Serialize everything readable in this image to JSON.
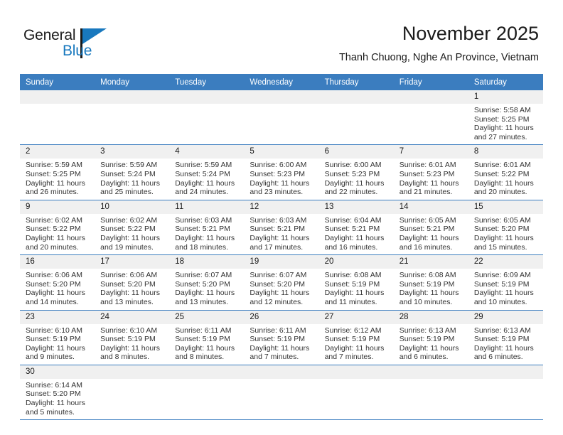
{
  "brand": {
    "name_top": "General",
    "name_bottom": "Blue",
    "accent_color": "#1878be",
    "flag_icon": "blue-triangle-flag"
  },
  "header": {
    "month_title": "November 2025",
    "location": "Thanh Chuong, Nghe An Province, Vietnam"
  },
  "calendar": {
    "header_color": "#3b7dbf",
    "daynum_band_color": "#f0f0f0",
    "weekdays": [
      "Sunday",
      "Monday",
      "Tuesday",
      "Wednesday",
      "Thursday",
      "Friday",
      "Saturday"
    ],
    "weeks": [
      [
        {
          "blank": true
        },
        {
          "blank": true
        },
        {
          "blank": true
        },
        {
          "blank": true
        },
        {
          "blank": true
        },
        {
          "blank": true
        },
        {
          "day": "1",
          "sunrise": "Sunrise: 5:58 AM",
          "sunset": "Sunset: 5:25 PM",
          "daylight_line1": "Daylight: 11 hours",
          "daylight_line2": "and 27 minutes."
        }
      ],
      [
        {
          "day": "2",
          "sunrise": "Sunrise: 5:59 AM",
          "sunset": "Sunset: 5:25 PM",
          "daylight_line1": "Daylight: 11 hours",
          "daylight_line2": "and 26 minutes."
        },
        {
          "day": "3",
          "sunrise": "Sunrise: 5:59 AM",
          "sunset": "Sunset: 5:24 PM",
          "daylight_line1": "Daylight: 11 hours",
          "daylight_line2": "and 25 minutes."
        },
        {
          "day": "4",
          "sunrise": "Sunrise: 5:59 AM",
          "sunset": "Sunset: 5:24 PM",
          "daylight_line1": "Daylight: 11 hours",
          "daylight_line2": "and 24 minutes."
        },
        {
          "day": "5",
          "sunrise": "Sunrise: 6:00 AM",
          "sunset": "Sunset: 5:23 PM",
          "daylight_line1": "Daylight: 11 hours",
          "daylight_line2": "and 23 minutes."
        },
        {
          "day": "6",
          "sunrise": "Sunrise: 6:00 AM",
          "sunset": "Sunset: 5:23 PM",
          "daylight_line1": "Daylight: 11 hours",
          "daylight_line2": "and 22 minutes."
        },
        {
          "day": "7",
          "sunrise": "Sunrise: 6:01 AM",
          "sunset": "Sunset: 5:23 PM",
          "daylight_line1": "Daylight: 11 hours",
          "daylight_line2": "and 21 minutes."
        },
        {
          "day": "8",
          "sunrise": "Sunrise: 6:01 AM",
          "sunset": "Sunset: 5:22 PM",
          "daylight_line1": "Daylight: 11 hours",
          "daylight_line2": "and 20 minutes."
        }
      ],
      [
        {
          "day": "9",
          "sunrise": "Sunrise: 6:02 AM",
          "sunset": "Sunset: 5:22 PM",
          "daylight_line1": "Daylight: 11 hours",
          "daylight_line2": "and 20 minutes."
        },
        {
          "day": "10",
          "sunrise": "Sunrise: 6:02 AM",
          "sunset": "Sunset: 5:22 PM",
          "daylight_line1": "Daylight: 11 hours",
          "daylight_line2": "and 19 minutes."
        },
        {
          "day": "11",
          "sunrise": "Sunrise: 6:03 AM",
          "sunset": "Sunset: 5:21 PM",
          "daylight_line1": "Daylight: 11 hours",
          "daylight_line2": "and 18 minutes."
        },
        {
          "day": "12",
          "sunrise": "Sunrise: 6:03 AM",
          "sunset": "Sunset: 5:21 PM",
          "daylight_line1": "Daylight: 11 hours",
          "daylight_line2": "and 17 minutes."
        },
        {
          "day": "13",
          "sunrise": "Sunrise: 6:04 AM",
          "sunset": "Sunset: 5:21 PM",
          "daylight_line1": "Daylight: 11 hours",
          "daylight_line2": "and 16 minutes."
        },
        {
          "day": "14",
          "sunrise": "Sunrise: 6:05 AM",
          "sunset": "Sunset: 5:21 PM",
          "daylight_line1": "Daylight: 11 hours",
          "daylight_line2": "and 16 minutes."
        },
        {
          "day": "15",
          "sunrise": "Sunrise: 6:05 AM",
          "sunset": "Sunset: 5:20 PM",
          "daylight_line1": "Daylight: 11 hours",
          "daylight_line2": "and 15 minutes."
        }
      ],
      [
        {
          "day": "16",
          "sunrise": "Sunrise: 6:06 AM",
          "sunset": "Sunset: 5:20 PM",
          "daylight_line1": "Daylight: 11 hours",
          "daylight_line2": "and 14 minutes."
        },
        {
          "day": "17",
          "sunrise": "Sunrise: 6:06 AM",
          "sunset": "Sunset: 5:20 PM",
          "daylight_line1": "Daylight: 11 hours",
          "daylight_line2": "and 13 minutes."
        },
        {
          "day": "18",
          "sunrise": "Sunrise: 6:07 AM",
          "sunset": "Sunset: 5:20 PM",
          "daylight_line1": "Daylight: 11 hours",
          "daylight_line2": "and 13 minutes."
        },
        {
          "day": "19",
          "sunrise": "Sunrise: 6:07 AM",
          "sunset": "Sunset: 5:20 PM",
          "daylight_line1": "Daylight: 11 hours",
          "daylight_line2": "and 12 minutes."
        },
        {
          "day": "20",
          "sunrise": "Sunrise: 6:08 AM",
          "sunset": "Sunset: 5:19 PM",
          "daylight_line1": "Daylight: 11 hours",
          "daylight_line2": "and 11 minutes."
        },
        {
          "day": "21",
          "sunrise": "Sunrise: 6:08 AM",
          "sunset": "Sunset: 5:19 PM",
          "daylight_line1": "Daylight: 11 hours",
          "daylight_line2": "and 10 minutes."
        },
        {
          "day": "22",
          "sunrise": "Sunrise: 6:09 AM",
          "sunset": "Sunset: 5:19 PM",
          "daylight_line1": "Daylight: 11 hours",
          "daylight_line2": "and 10 minutes."
        }
      ],
      [
        {
          "day": "23",
          "sunrise": "Sunrise: 6:10 AM",
          "sunset": "Sunset: 5:19 PM",
          "daylight_line1": "Daylight: 11 hours",
          "daylight_line2": "and 9 minutes."
        },
        {
          "day": "24",
          "sunrise": "Sunrise: 6:10 AM",
          "sunset": "Sunset: 5:19 PM",
          "daylight_line1": "Daylight: 11 hours",
          "daylight_line2": "and 8 minutes."
        },
        {
          "day": "25",
          "sunrise": "Sunrise: 6:11 AM",
          "sunset": "Sunset: 5:19 PM",
          "daylight_line1": "Daylight: 11 hours",
          "daylight_line2": "and 8 minutes."
        },
        {
          "day": "26",
          "sunrise": "Sunrise: 6:11 AM",
          "sunset": "Sunset: 5:19 PM",
          "daylight_line1": "Daylight: 11 hours",
          "daylight_line2": "and 7 minutes."
        },
        {
          "day": "27",
          "sunrise": "Sunrise: 6:12 AM",
          "sunset": "Sunset: 5:19 PM",
          "daylight_line1": "Daylight: 11 hours",
          "daylight_line2": "and 7 minutes."
        },
        {
          "day": "28",
          "sunrise": "Sunrise: 6:13 AM",
          "sunset": "Sunset: 5:19 PM",
          "daylight_line1": "Daylight: 11 hours",
          "daylight_line2": "and 6 minutes."
        },
        {
          "day": "29",
          "sunrise": "Sunrise: 6:13 AM",
          "sunset": "Sunset: 5:19 PM",
          "daylight_line1": "Daylight: 11 hours",
          "daylight_line2": "and 6 minutes."
        }
      ],
      [
        {
          "day": "30",
          "sunrise": "Sunrise: 6:14 AM",
          "sunset": "Sunset: 5:20 PM",
          "daylight_line1": "Daylight: 11 hours",
          "daylight_line2": "and 5 minutes."
        },
        {
          "blank": true
        },
        {
          "blank": true
        },
        {
          "blank": true
        },
        {
          "blank": true
        },
        {
          "blank": true
        },
        {
          "blank": true
        }
      ]
    ]
  }
}
